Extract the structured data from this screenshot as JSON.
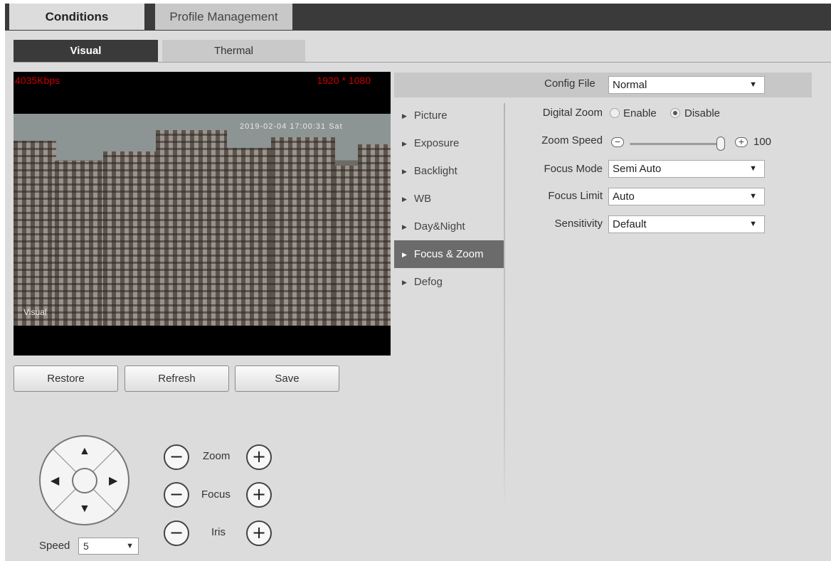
{
  "tabs": {
    "conditions": "Conditions",
    "profile_management": "Profile Management"
  },
  "subtabs": {
    "visual": "Visual",
    "thermal": "Thermal"
  },
  "video": {
    "bitrate": "4035Kbps",
    "resolution": "1920 * 1080",
    "timestamp": "2019-02-04 17:00:31 Sat",
    "channel_label": "Visual"
  },
  "buttons": {
    "restore": "Restore",
    "refresh": "Refresh",
    "save": "Save"
  },
  "ptz": {
    "speed_label": "Speed",
    "speed_value": "5",
    "zoom_label": "Zoom",
    "focus_label": "Focus",
    "iris_label": "Iris",
    "minus_glyph": "−",
    "plus_glyph": "+",
    "arrows": {
      "up": "▲",
      "down": "▼",
      "left": "◀",
      "right": "▶"
    }
  },
  "config": {
    "label": "Config File",
    "value": "Normal"
  },
  "menu": [
    {
      "label": "Picture",
      "active": false
    },
    {
      "label": "Exposure",
      "active": false
    },
    {
      "label": "Backlight",
      "active": false
    },
    {
      "label": "WB",
      "active": false
    },
    {
      "label": "Day&Night",
      "active": false
    },
    {
      "label": "Focus & Zoom",
      "active": true
    },
    {
      "label": "Defog",
      "active": false
    }
  ],
  "settings": {
    "digital_zoom": {
      "label": "Digital Zoom",
      "enable": "Enable",
      "disable": "Disable",
      "selected": "Disable"
    },
    "zoom_speed": {
      "label": "Zoom Speed",
      "value": "100",
      "level_fraction": 1.0
    },
    "focus_mode": {
      "label": "Focus Mode",
      "value": "Semi Auto"
    },
    "focus_limit": {
      "label": "Focus Limit",
      "value": "Auto"
    },
    "sensitivity": {
      "label": "Sensitivity",
      "value": "Default"
    }
  },
  "icons": {
    "dropdown": "▼",
    "menu_arrow": "▶"
  },
  "colors": {
    "osd_red": "#cc0000",
    "dark_tab": "#3a3a3a",
    "active_menu": "#6b6b6b"
  }
}
